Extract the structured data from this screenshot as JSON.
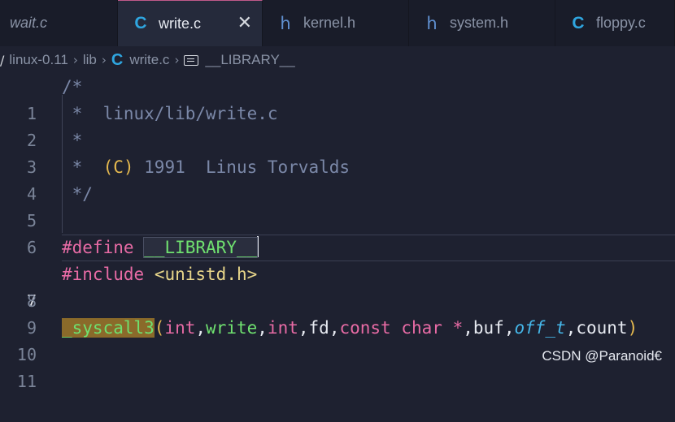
{
  "tabs": [
    {
      "label": "wait.c",
      "icon": "",
      "italic": true,
      "active": false
    },
    {
      "label": "write.c",
      "icon": "c-file-icon",
      "glyph": "C",
      "active": true,
      "close": "✕"
    },
    {
      "label": "kernel.h",
      "icon": "h-file-icon",
      "glyph": "h",
      "active": false
    },
    {
      "label": "system.h",
      "icon": "h-file-icon",
      "glyph": "h",
      "active": false
    },
    {
      "label": "floppy.c",
      "icon": "c-file-icon",
      "glyph": "C",
      "active": false
    }
  ],
  "breadcrumb": {
    "root": "linux-0.11",
    "folder": "lib",
    "file": "write.c",
    "symbol": "__LIBRARY__",
    "file_icon_glyph": "C",
    "separator": "›"
  },
  "editor": {
    "current_line": 7,
    "lines": [
      {
        "n": "1",
        "text": "/*"
      },
      {
        "n": "2",
        "text": " *  linux/lib/write.c"
      },
      {
        "n": "3",
        "text": " *"
      },
      {
        "n": "4",
        "text": " *  (C) 1991  Linus Torvalds"
      },
      {
        "n": "5",
        "text": " */"
      },
      {
        "n": "6",
        "text": ""
      },
      {
        "n": "7",
        "text": "#define __LIBRARY__"
      },
      {
        "n": "8",
        "text": "#include <unistd.h>"
      },
      {
        "n": "9",
        "text": ""
      },
      {
        "n": "10",
        "text": "_syscall3(int,write,int,fd,const char *,buf,off_t,count)"
      },
      {
        "n": "11",
        "text": ""
      }
    ],
    "tokens": {
      "l1": "/*",
      "l2": " *  linux/lib/write.c",
      "l3": " *",
      "l4a": " *  ",
      "l4b": "(C)",
      "l4c": " 1991  Linus Torvalds",
      "l5": " */",
      "l7a": "#define",
      "l7b": "__LIBRARY__",
      "l8a": "#include",
      "l8b": "<unistd.h>",
      "l10_fn": "_syscall3",
      "l10_open": "(",
      "l10_int1": "int",
      "l10_c1": ",",
      "l10_write": "write",
      "l10_c2": ",",
      "l10_int2": "int",
      "l10_c3": ",",
      "l10_fd": "fd",
      "l10_c4": ",",
      "l10_const": "const",
      "l10_char": "char",
      "l10_star": "*",
      "l10_c5": ",",
      "l10_buf": "buf",
      "l10_c6": ",",
      "l10_offt": "off_t",
      "l10_c7": ",",
      "l10_count": "count",
      "l10_close": ")"
    }
  },
  "watermark": "CSDN @Paranoid€",
  "colors": {
    "background": "#1e2130",
    "comment": "#7b88a8",
    "keyword": "#e86ba5",
    "function": "#6fe06f",
    "type": "#45b6e8",
    "string": "#e8d68a",
    "paren": "#e5b94f",
    "c_icon": "#2fa6e0"
  }
}
